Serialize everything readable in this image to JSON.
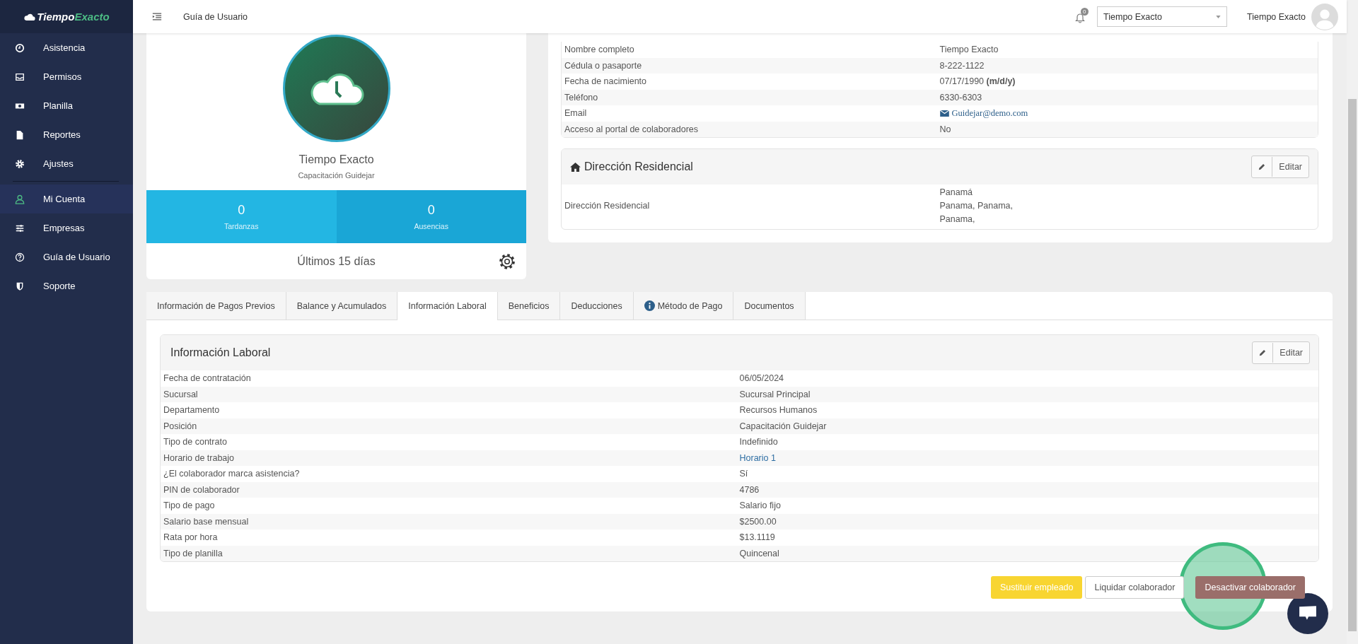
{
  "brand": {
    "part1": "Tiempo",
    "part2": "Exacto"
  },
  "sidebar": {
    "groups": [
      [
        {
          "label": "Asistencia",
          "kind": "clock",
          "selected": false
        },
        {
          "label": "Permisos",
          "kind": "inbox",
          "selected": false
        },
        {
          "label": "Planilla",
          "kind": "money",
          "selected": false
        },
        {
          "label": "Reportes",
          "kind": "file",
          "selected": false
        },
        {
          "label": "Ajustes",
          "kind": "gear",
          "selected": false
        }
      ],
      [
        {
          "label": "Mi Cuenta",
          "kind": "user",
          "selected": true
        },
        {
          "label": "Empresas",
          "kind": "sliders",
          "selected": false
        },
        {
          "label": "Guía de Usuario",
          "kind": "help",
          "selected": false
        },
        {
          "label": "Soporte",
          "kind": "shield",
          "selected": false
        }
      ]
    ]
  },
  "topbar": {
    "page_title": "Guía de Usuario",
    "notification_count": "0",
    "company_select": "Tiempo Exacto",
    "user_name": "Tiempo Exacto"
  },
  "profile": {
    "name": "Tiempo Exacto",
    "subtitle": "Capacitación Guidejar",
    "stats": [
      {
        "value": "0",
        "label": "Tardanzas"
      },
      {
        "value": "0",
        "label": "Ausencias"
      }
    ],
    "footer": "Últimos 15 días"
  },
  "personal_info": [
    {
      "label": "Nombre completo",
      "value": "Tiempo Exacto",
      "kind": "text"
    },
    {
      "label": "Cédula o pasaporte",
      "value": "8-222-1122",
      "kind": "text"
    },
    {
      "label": "Fecha de nacimiento",
      "value": "07/17/1990 **(m/d/y)**",
      "kind": "text"
    },
    {
      "label": "Teléfono",
      "value": "6330-6303",
      "kind": "text"
    },
    {
      "label": "Email",
      "value": "Guidejar@demo.com",
      "kind": "email"
    },
    {
      "label": "Acceso al portal de colaboradores",
      "value": "No",
      "kind": "text"
    }
  ],
  "address": {
    "title": "Dirección Residencial",
    "edit": "Editar",
    "label": "Dirección Residencial",
    "lines": [
      "Panamá",
      "Panama, Panama,",
      "Panama,"
    ]
  },
  "tabs": [
    {
      "label": "Información de Pagos Previos",
      "selected": false,
      "kind": "plain"
    },
    {
      "label": "Balance y Acumulados",
      "selected": false,
      "kind": "plain"
    },
    {
      "label": "Información Laboral",
      "selected": true,
      "kind": "plain"
    },
    {
      "label": "Beneficios",
      "selected": false,
      "kind": "plain"
    },
    {
      "label": "Deducciones",
      "selected": false,
      "kind": "plain"
    },
    {
      "label": "Método de Pago",
      "selected": false,
      "kind": "info"
    },
    {
      "label": "Documentos",
      "selected": false,
      "kind": "plain"
    }
  ],
  "work_info": {
    "title": "Información Laboral",
    "edit": "Editar",
    "rows": [
      {
        "label": "Fecha de contratación",
        "value": "06/05/2024",
        "kind": "text"
      },
      {
        "label": "Sucursal",
        "value": "Sucursal Principal",
        "kind": "text"
      },
      {
        "label": "Departamento",
        "value": "Recursos Humanos",
        "kind": "text"
      },
      {
        "label": "Posición",
        "value": "Capacitación Guidejar",
        "kind": "text"
      },
      {
        "label": "Tipo de contrato",
        "value": "Indefinido",
        "kind": "text"
      },
      {
        "label": "Horario de trabajo",
        "value": "Horario 1",
        "kind": "link"
      },
      {
        "label": "¿El colaborador marca asistencia?",
        "value": "Sí",
        "kind": "text"
      },
      {
        "label": "PIN de colaborador",
        "value": "4786",
        "kind": "text"
      },
      {
        "label": "Tipo de pago",
        "value": "Salario fijo",
        "kind": "text"
      },
      {
        "label": "Salario base mensual",
        "value": "$2500.00",
        "kind": "text"
      },
      {
        "label": "Rata por hora",
        "value": "$13.1119",
        "kind": "text"
      },
      {
        "label": "Tipo de planilla",
        "value": "Quincenal",
        "kind": "text"
      }
    ]
  },
  "actions": [
    {
      "label": "Sustituir empleado",
      "kind": "warning"
    },
    {
      "label": "Liquidar colaborador",
      "kind": "default"
    },
    {
      "label": "Desactivar colaborador",
      "kind": "danger",
      "highlighted": true
    }
  ]
}
